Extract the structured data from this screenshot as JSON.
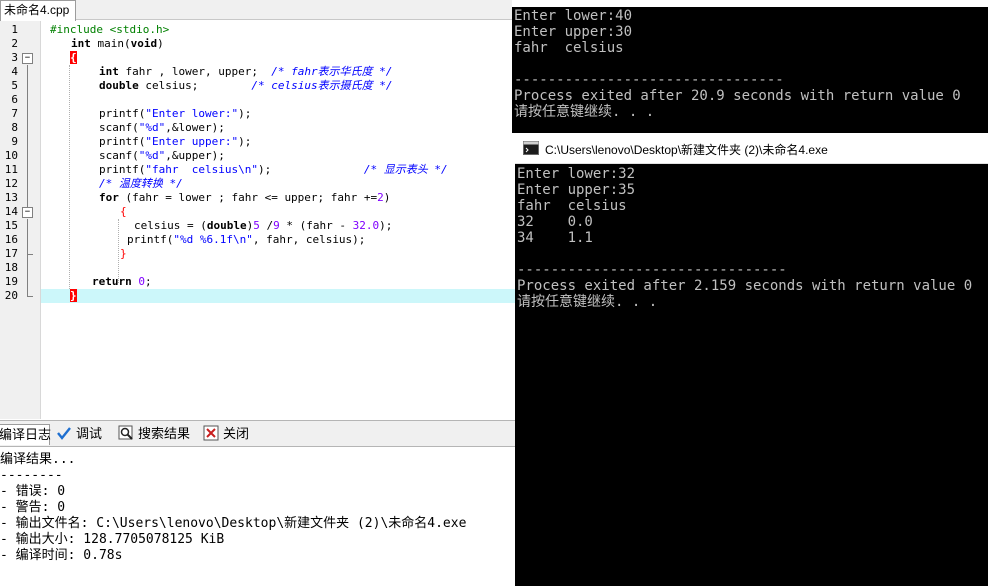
{
  "ide": {
    "file_tab": "未命名4.cpp",
    "line_numbers": [
      "1",
      "2",
      "3",
      "4",
      "5",
      "6",
      "7",
      "8",
      "9",
      "10",
      "11",
      "12",
      "13",
      "14",
      "15",
      "16",
      "17",
      "18",
      "19",
      "20"
    ],
    "code": {
      "l1": "#include <stdio.h>",
      "l2_kw": "int",
      "l2_rest": " main(",
      "l2_kw2": "void",
      "l2_end": ")",
      "l3": "{",
      "l4_kw": "int",
      "l4_rest": " fahr , lower, upper;  ",
      "l4_cmt": "/* fahr表示华氏度 */",
      "l5_kw": "double",
      "l5_rest": " celsius;        ",
      "l5_cmt": "/* celsius表示摄氏度 */",
      "l7_fn": "printf(",
      "l7_str": "\"Enter lower:\"",
      "l7_end": ");",
      "l8_fn": "scanf(",
      "l8_str": "\"%d\"",
      "l8_end": ",&lower);",
      "l9_fn": "printf(",
      "l9_str": "\"Enter upper:\"",
      "l9_end": ");",
      "l10_fn": "scanf(",
      "l10_str": "\"%d\"",
      "l10_end": ",&upper);",
      "l11_fn": "printf(",
      "l11_str": "\"fahr  celsius\\n\"",
      "l11_end": ");              ",
      "l11_cmt": "/* 显示表头 */",
      "l12_cmt": "/* 温度转换 */",
      "l13_kw": "for",
      "l13_rest": " (fahr = lower ; fahr <= upper; fahr +=",
      "l13_num": "2",
      "l13_end": ")",
      "l14": "{",
      "l15_a": "celsius = (",
      "l15_kw": "double",
      "l15_b": ")",
      "l15_n1": "5",
      "l15_c": " /",
      "l15_n2": "9",
      "l15_d": " * (fahr - ",
      "l15_n3": "32.0",
      "l15_e": ");",
      "l16_fn": "printf(",
      "l16_str": "\"%d %6.1f\\n\"",
      "l16_end": ", fahr, celsius);",
      "l17": "}",
      "l19_kw": "return",
      "l19_num": "0",
      "l19_end": ";",
      "l20": "}"
    }
  },
  "bottom_panel": {
    "tabs": [
      {
        "label": "编译日志",
        "icon": "compile-log-icon"
      },
      {
        "label": "调试",
        "icon": "debug-check-icon"
      },
      {
        "label": "搜索结果",
        "icon": "search-results-icon"
      },
      {
        "label": "关闭",
        "icon": "close-icon"
      }
    ],
    "log_lines": [
      "编译结果...",
      "--------",
      "- 错误: 0",
      "- 警告: 0",
      "- 输出文件名: C:\\Users\\lenovo\\Desktop\\新建文件夹 (2)\\未命名4.exe",
      "- 输出大小: 128.7705078125 KiB",
      "- 编译时间: 0.78s"
    ]
  },
  "console1": {
    "lines": [
      "Enter lower:40",
      "Enter upper:30",
      "fahr  celsius",
      "",
      "--------------------------------",
      "Process exited after 20.9 seconds with return value 0",
      "请按任意键继续. . ."
    ]
  },
  "console2": {
    "title": "C:\\Users\\lenovo\\Desktop\\新建文件夹 (2)\\未命名4.exe",
    "lines": [
      "Enter lower:32",
      "Enter upper:35",
      "fahr  celsius",
      "32    0.0",
      "34    1.1",
      "",
      "--------------------------------",
      "Process exited after 2.159 seconds with return value 0",
      "请按任意键继续. . ."
    ]
  },
  "colors": {
    "current_line": "#ccf7fa",
    "string": "#0000ff",
    "comment": "#0000ff",
    "number": "#8000ff",
    "preprocessor": "#008000",
    "brace_highlight": "#ff0000",
    "console_bg": "#000000",
    "console_text": "#c0c0c0"
  }
}
